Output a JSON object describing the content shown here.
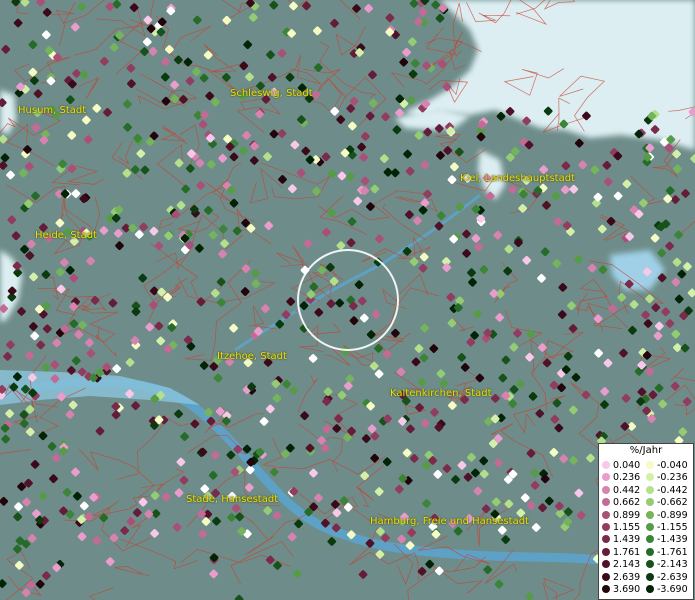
{
  "colors": {
    "land": "#6e8d8a",
    "water": "#dceef2",
    "river": "#5aa6d0",
    "borders": "#c8402f",
    "label": "#f0e000"
  },
  "cities": [
    {
      "name": "Husum, Stadt"
    },
    {
      "name": "Schleswig, Stadt"
    },
    {
      "name": "Kiel, Landeshauptstadt"
    },
    {
      "name": "Heide, Stadt"
    },
    {
      "name": "Itzehoe, Stadt"
    },
    {
      "name": "Kaltenkirchen, Stadt"
    },
    {
      "name": "Stade, Hansestadt"
    },
    {
      "name": "Hamburg, Freie und Hansestadt"
    }
  ],
  "legend": {
    "title": "%/Jahr",
    "positive": [
      {
        "label": "0.040",
        "color": "#f8c8e8"
      },
      {
        "label": "0.236",
        "color": "#ea9ccc"
      },
      {
        "label": "0.442",
        "color": "#d882b0"
      },
      {
        "label": "0.662",
        "color": "#c46a96"
      },
      {
        "label": "0.899",
        "color": "#aa5078"
      },
      {
        "label": "1.155",
        "color": "#923c60"
      },
      {
        "label": "1.439",
        "color": "#7a2a4a"
      },
      {
        "label": "1.761",
        "color": "#651c38"
      },
      {
        "label": "2.143",
        "color": "#501228"
      },
      {
        "label": "2.639",
        "color": "#3a0a1a"
      },
      {
        "label": "3.690",
        "color": "#22040c"
      }
    ],
    "negative": [
      {
        "label": "-0.040",
        "color": "#f4fcc4"
      },
      {
        "label": "-0.236",
        "color": "#d4f0a8"
      },
      {
        "label": "-0.442",
        "color": "#b4e08c"
      },
      {
        "label": "-0.662",
        "color": "#94cc74"
      },
      {
        "label": "-0.899",
        "color": "#74b45c"
      },
      {
        "label": "-1.155",
        "color": "#569c48"
      },
      {
        "label": "-1.439",
        "color": "#3c8438"
      },
      {
        "label": "-1.761",
        "color": "#266c28"
      },
      {
        "label": "-2.143",
        "color": "#16521a"
      },
      {
        "label": "-2.639",
        "color": "#0a3a0e"
      },
      {
        "label": "-3.690",
        "color": "#022406"
      }
    ]
  }
}
